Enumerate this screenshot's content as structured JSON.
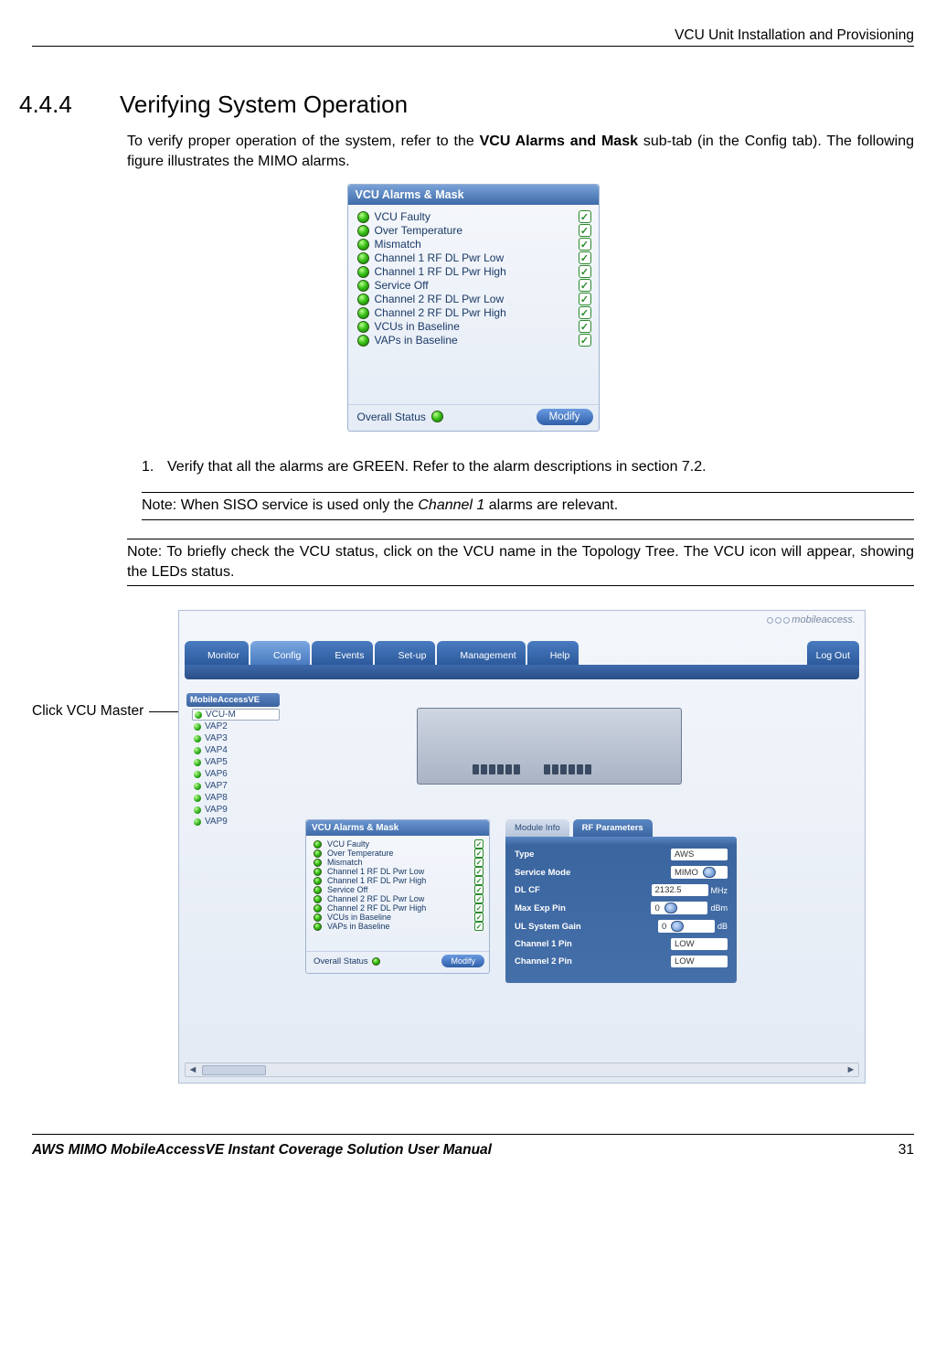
{
  "header": {
    "right": "VCU Unit Installation and Provisioning"
  },
  "section": {
    "number": "4.4.4",
    "title": "Verifying System Operation",
    "intro_a": "To verify proper operation of the system, refer to the ",
    "intro_b": "VCU Alarms and Mask",
    "intro_c": " sub-tab (in the Config tab). The following figure illustrates the MIMO alarms."
  },
  "panel1": {
    "title": "VCU Alarms & Mask",
    "alarms": [
      "VCU Faulty",
      "Over Temperature",
      "Mismatch",
      "Channel 1 RF DL Pwr Low",
      "Channel 1 RF DL Pwr High",
      "Service Off",
      "Channel 2 RF DL Pwr Low",
      "Channel 2 RF DL Pwr High",
      "VCUs in Baseline",
      "VAPs in Baseline"
    ],
    "overall": "Overall Status",
    "modify": "Modify"
  },
  "step1": {
    "num": "1.",
    "text": "Verify that all the alarms are GREEN. Refer to the alarm descriptions in section 7.2."
  },
  "note1_a": "Note: When SISO service is used only the ",
  "note1_b": "Channel 1",
  "note1_c": " alarms are relevant.",
  "note2": "Note: To briefly check the VCU status, click on the VCU name in the Topology Tree. The VCU icon will appear, showing the LEDs status.",
  "annot": "Click VCU Master",
  "shot2": {
    "logo": "mobileaccess.",
    "tabs": [
      "Monitor",
      "Config",
      "Events",
      "Set-up",
      "Management",
      "Help"
    ],
    "logout": "Log Out",
    "tree_title": "MobileAccessVE",
    "tree": [
      "VCU-M",
      "VAP2",
      "VAP3",
      "VAP4",
      "VAP5",
      "VAP6",
      "VAP7",
      "VAP8",
      "VAP9",
      "VAP9"
    ],
    "lp1_title": "VCU Alarms & Mask",
    "lp1_alarms": [
      "VCU Faulty",
      "Over Temperature",
      "Mismatch",
      "Channel 1 RF DL Pwr Low",
      "Channel 1 RF DL Pwr High",
      "Service Off",
      "Channel 2 RF DL Pwr Low",
      "Channel 2 RF DL Pwr High",
      "VCUs in Baseline",
      "VAPs in Baseline"
    ],
    "overall": "Overall Status",
    "modify": "Modify",
    "lp2_t1": "Module Info",
    "lp2_t2": "RF Parameters",
    "params": {
      "k_type": "Type",
      "v_type": "AWS",
      "k_mode": "Service Mode",
      "v_mode": "MIMO",
      "k_dlcf": "DL CF",
      "v_dlcf": "2132.5",
      "u_mhz": "MHz",
      "k_max": "Max Exp Pin",
      "v_max": "0",
      "u_dbm": "dBm",
      "k_ul": "UL System Gain",
      "v_ul": "0",
      "u_db": "dB",
      "k_c1": "Channel 1 Pin",
      "v_c1": "LOW",
      "k_c2": "Channel 2 Pin",
      "v_c2": "LOW"
    }
  },
  "footer": {
    "left": "AWS MIMO MobileAccessVE Instant Coverage Solution User Manual",
    "right": "31"
  }
}
